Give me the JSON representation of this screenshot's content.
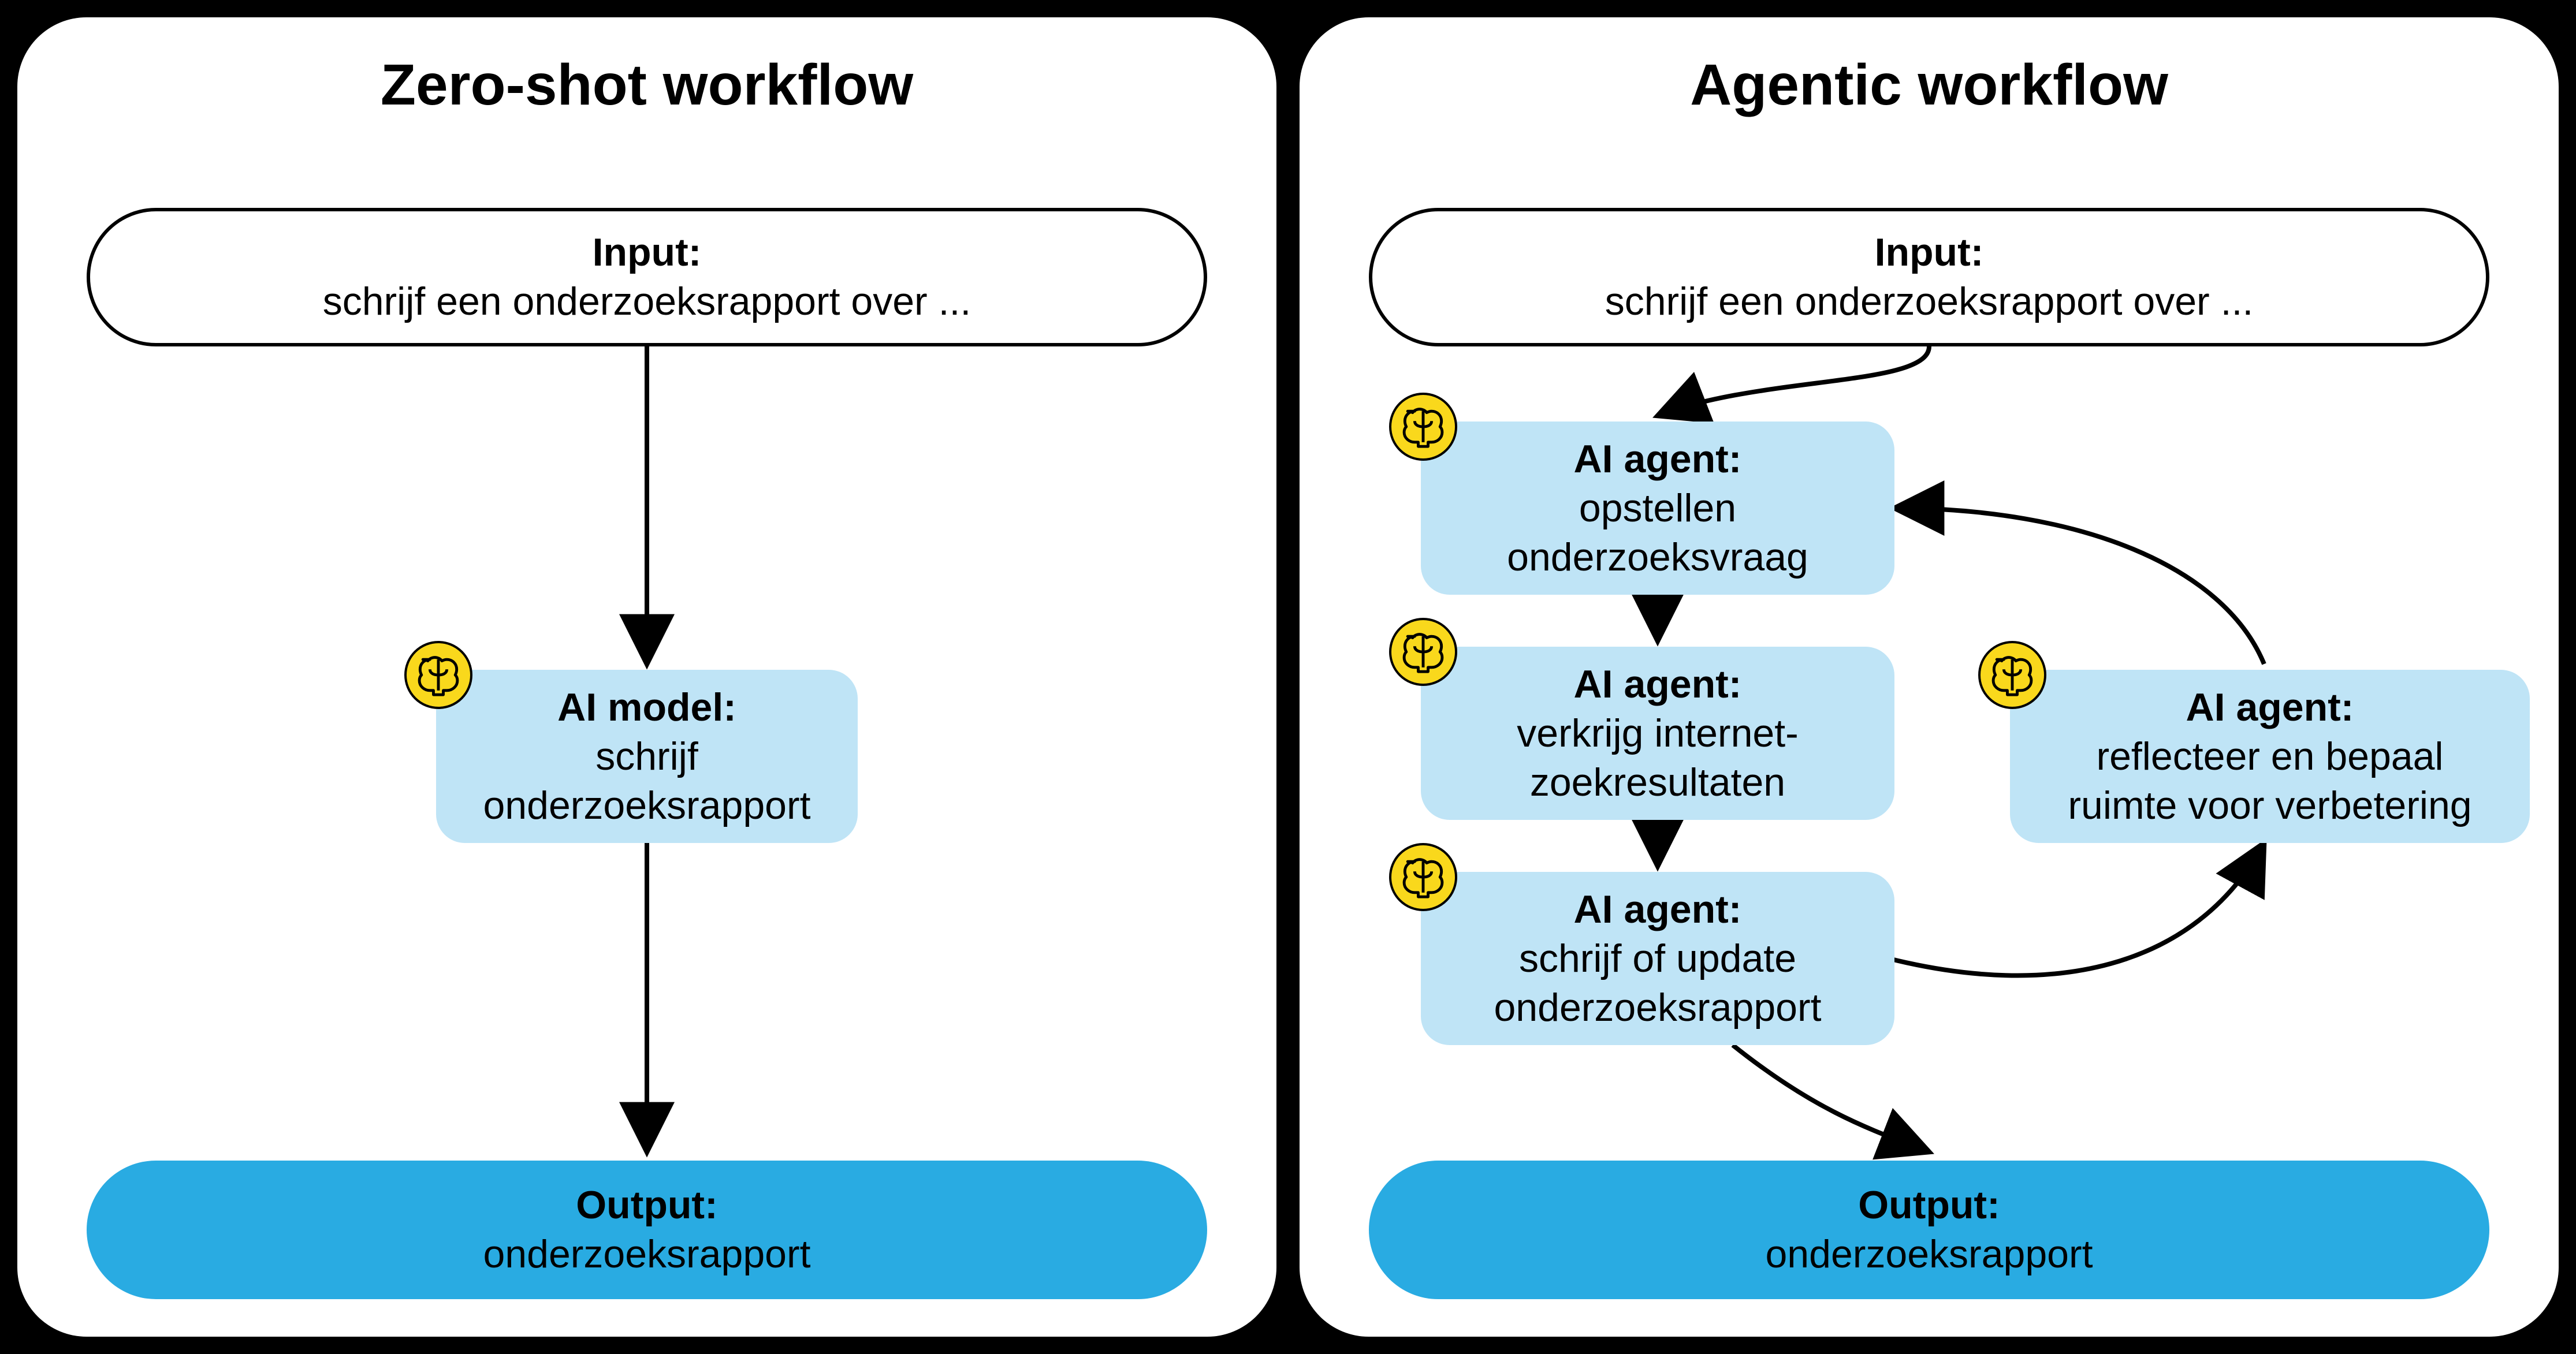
{
  "left": {
    "title": "Zero-shot workflow",
    "input": {
      "label": "Input:",
      "text": "schrijf een onderzoeksrapport over ..."
    },
    "model": {
      "label": "AI model:",
      "line1": "schrijf",
      "line2": "onderzoeksrapport"
    },
    "output": {
      "label": "Output:",
      "text": "onderzoeksrapport"
    }
  },
  "right": {
    "title": "Agentic workflow",
    "input": {
      "label": "Input:",
      "text": "schrijf een onderzoeksrapport over ..."
    },
    "agent1": {
      "label": "AI agent:",
      "line1": "opstellen",
      "line2": "onderzoeksvraag"
    },
    "agent2": {
      "label": "AI agent:",
      "line1": "verkrijg internet-",
      "line2": "zoekresultaten"
    },
    "agent3": {
      "label": "AI agent:",
      "line1": "schrijf of update",
      "line2": "onderzoeksrapport"
    },
    "agent4": {
      "label": "AI agent:",
      "line1": "reflecteer en bepaal",
      "line2": "ruimte voor verbetering"
    },
    "output": {
      "label": "Output:",
      "text": "onderzoeksrapport"
    }
  },
  "colors": {
    "node_light_blue": "#bfe4f6",
    "node_blue": "#29abe2",
    "brain_yellow": "#f9d81c",
    "background": "#000000"
  }
}
